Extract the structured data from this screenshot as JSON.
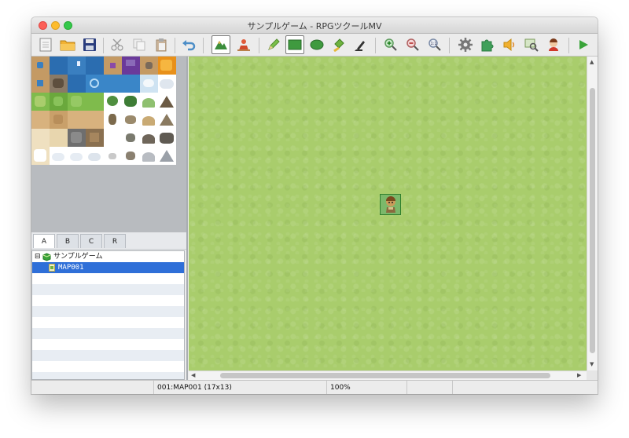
{
  "window": {
    "title": "サンプルゲーム - RPGツクールMV"
  },
  "toolbar": {
    "buttons": [
      "new-project",
      "open-project",
      "save-project",
      "cut",
      "copy",
      "paste",
      "undo",
      "map-mode",
      "event-mode",
      "pencil",
      "rectangle",
      "ellipse",
      "flood-fill",
      "shadow-pen",
      "zoom-in",
      "zoom-out",
      "actual-size",
      "database",
      "plugin-manager",
      "sound-test",
      "event-searcher",
      "character-generator",
      "playtest"
    ],
    "active": [
      "map-mode",
      "rectangle"
    ]
  },
  "tileset_tabs": [
    "A",
    "B",
    "C",
    "R"
  ],
  "tileset_selected_tab": "A",
  "map_tree": {
    "project": "サンプルゲーム",
    "maps": [
      {
        "name": "MAP001",
        "selected": true
      }
    ],
    "expand_symbol": "⊟"
  },
  "status": {
    "map_info": "001:MAP001 (17x13)",
    "zoom": "100%"
  },
  "colors": {
    "grass": "#a9cd6c",
    "selection": "#2f6fd8"
  }
}
